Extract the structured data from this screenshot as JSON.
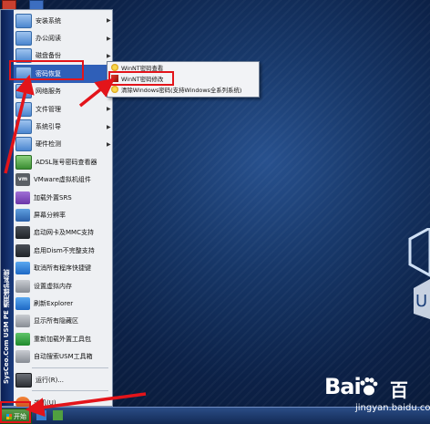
{
  "start_menu": {
    "brand": "SysCeo.Com USM PE 通用维护系统",
    "items": [
      {
        "label": "安装系统",
        "icon": "folder-icon",
        "submenu": true
      },
      {
        "label": "办公阅读",
        "icon": "folder-icon",
        "submenu": true
      },
      {
        "label": "磁盘备份",
        "icon": "folder-icon",
        "submenu": true
      },
      {
        "label": "密码恢复",
        "icon": "folder-icon",
        "submenu": true,
        "highlighted": true
      },
      {
        "label": "网络服务",
        "icon": "folder-icon",
        "submenu": true
      },
      {
        "label": "文件管理",
        "icon": "folder-icon",
        "submenu": true
      },
      {
        "label": "系统引导",
        "icon": "folder-icon",
        "submenu": true
      },
      {
        "label": "硬件检测",
        "icon": "folder-icon",
        "submenu": true
      },
      {
        "label": "ADSL账号密码查看器",
        "icon": "app-icon",
        "submenu": false
      },
      {
        "label": "VMware虚拟机组件",
        "icon": "vmware-icon",
        "submenu": false
      },
      {
        "label": "加载外置SRS",
        "icon": "srs-icon",
        "submenu": false
      },
      {
        "label": "屏幕分辨率",
        "icon": "screen-icon",
        "submenu": false
      },
      {
        "label": "启动网卡及MMC支持",
        "icon": "network-card-icon",
        "submenu": false
      },
      {
        "label": "启用Dism不完整支持",
        "icon": "dism-icon",
        "submenu": false
      },
      {
        "label": "取消所有程序快捷键",
        "icon": "shortcut-icon",
        "submenu": false
      },
      {
        "label": "设置虚拟内存",
        "icon": "memory-icon",
        "submenu": false
      },
      {
        "label": "刷新Explorer",
        "icon": "refresh-icon",
        "submenu": false
      },
      {
        "label": "显示所有隐藏区",
        "icon": "drive-icon",
        "submenu": false
      },
      {
        "label": "重新加载外置工具包",
        "icon": "toolkit-icon",
        "submenu": false
      },
      {
        "label": "自动搜索USM工具箱",
        "icon": "search-toolbox-icon",
        "submenu": false
      }
    ],
    "run": "运行(R)...",
    "shutdown": "关机(U)..."
  },
  "submenu": {
    "items": [
      {
        "label": "WinNT密码查看",
        "icon": "key-icon"
      },
      {
        "label": "WinNT密码修改",
        "icon": "tool-icon",
        "boxed": true
      },
      {
        "label": "清除Windows密码(支持Windows全系列系统)",
        "icon": "key-icon"
      }
    ]
  },
  "taskbar": {
    "start_label": "开始"
  },
  "watermark": {
    "main": "Bai",
    "main_suffix": "百",
    "sub": "jingyan.baidu.com"
  },
  "colors": {
    "annotation": "#e3141a",
    "highlight": "#2f5fb8",
    "sidebar": "#0b1f52"
  }
}
